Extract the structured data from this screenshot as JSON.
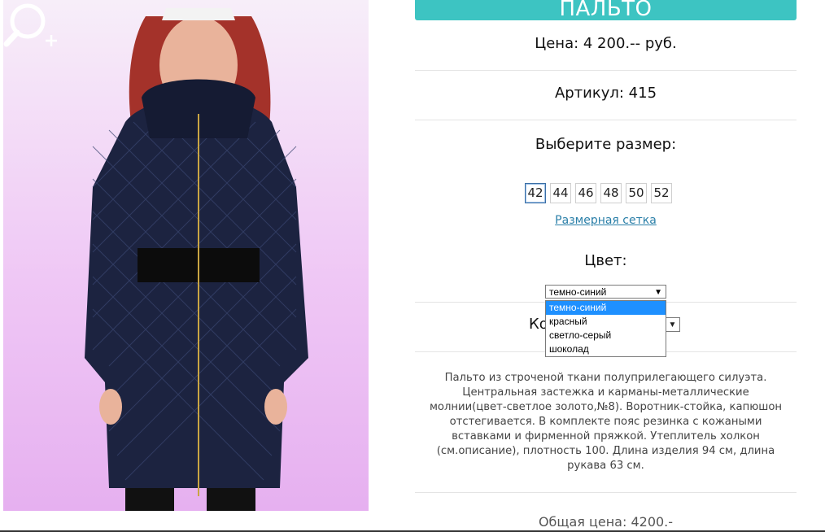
{
  "product": {
    "title": "ПАЛЬТО",
    "price_label": "Цена: 4 200.-- руб.",
    "article_label": "Артикул: 415"
  },
  "size_section": {
    "heading": "Выберите размер:",
    "sizes": [
      "42",
      "44",
      "46",
      "48",
      "50",
      "52"
    ],
    "selected": "42",
    "size_chart_link": "Размерная сетка"
  },
  "color_section": {
    "heading": "Цвет:",
    "selected_value": "темно-синий",
    "options": [
      "темно-синий",
      "красный",
      "светло-серый",
      "шоколад"
    ],
    "highlighted_option": "темно-синий"
  },
  "quantity_section": {
    "label_partial": "Ко"
  },
  "description": "Пальто из строченой ткани полуприлегающего силуэта. Центральная застежка и карманы-металлические молнии(цвет-светлое золото,№8). Воротник-стойка, капюшон отстегивается. В комплекте пояс резинка с кожаными вставками и фирменной пряжкой. Утеплитель холкон (см.описание), плотность 100. Длина изделия 94 см, длина рукава 63 см.",
  "total_label": "Общая цена: 4200.-",
  "colors": {
    "title_bar": "#3dc4c2",
    "link": "#2a7fa8",
    "option_highlight": "#1e90ff",
    "coat": "#1c2340",
    "background_gradient_end": "#e6b0f0"
  },
  "icons": {
    "zoom": "zoom-in-icon",
    "dropdown_arrow": "triangle-down-icon"
  }
}
